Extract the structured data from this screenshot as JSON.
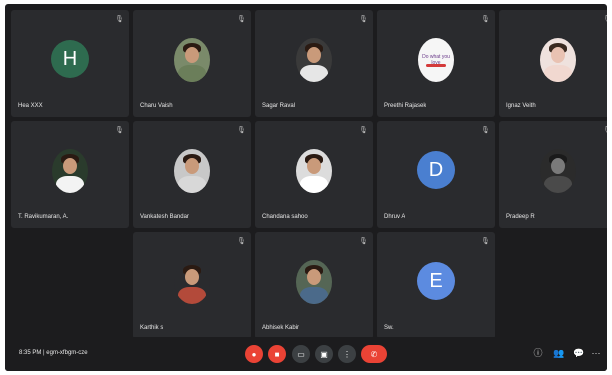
{
  "meeting": {
    "time": "8:35 PM",
    "separator": "|",
    "code": "egm-xfbgm-cze"
  },
  "participants": [
    {
      "name": "Hea XXX",
      "avatar": {
        "type": "letter",
        "letter": "H",
        "color": "#2e6b4f"
      }
    },
    {
      "name": "Charu Vaish",
      "avatar": {
        "type": "photo",
        "shirt": "#6b7e5a",
        "bg": "#7a8a6a"
      }
    },
    {
      "name": "Sagar Raval",
      "avatar": {
        "type": "photo",
        "shirt": "#e6e6e6",
        "bg": "#3a3a3a"
      }
    },
    {
      "name": "Preethi Rajasek",
      "avatar": {
        "type": "logo",
        "text": "Do what you love"
      }
    },
    {
      "name": "Ignaz Veith",
      "avatar": {
        "type": "photo",
        "shirt": "#f1d8d0",
        "bg": "#efe2de"
      }
    },
    {
      "name": "T. Ravikumaran, A.",
      "avatar": {
        "type": "photo",
        "shirt": "#f3f3f3",
        "bg": "#2a3b2c"
      }
    },
    {
      "name": "Vankatesh Bandar",
      "avatar": {
        "type": "photo",
        "shirt": "#d8d8d8",
        "bg": "#c8c8c8"
      }
    },
    {
      "name": "Chandana sahoo",
      "avatar": {
        "type": "photo",
        "shirt": "#ffffff",
        "bg": "#dcdcdc"
      }
    },
    {
      "name": "Dhruv A",
      "avatar": {
        "type": "letter",
        "letter": "D",
        "color": "#4a7fd0"
      }
    },
    {
      "name": "Pradeep R",
      "avatar": {
        "type": "photo",
        "shirt": "#4a4a4a",
        "bg": "#2b2b2b"
      }
    },
    {
      "name": "Karthik s",
      "avatar": {
        "type": "photo",
        "shirt": "#b34a3a",
        "bg": "#2a2b2e"
      }
    },
    {
      "name": "Abhisek Kabir",
      "avatar": {
        "type": "photo",
        "shirt": "#4b6a8a",
        "bg": "#556655"
      }
    },
    {
      "name": "Sw.",
      "avatar": {
        "type": "letter",
        "letter": "E",
        "color": "#5c8be0"
      }
    }
  ],
  "controls": {
    "mic_label": "mic-off",
    "cam_label": "camera-off",
    "captions_label": "captions",
    "present_label": "present",
    "more_label": "more",
    "end_label": "end-call"
  },
  "icons": {
    "mic_muted": "🎙",
    "more": "⋮",
    "end": "✆",
    "info": "ⓘ",
    "people": "👥",
    "chat": "💬",
    "activities": "⋯"
  },
  "colors": {
    "background": "#1c1c1e",
    "tile": "#2a2b2e",
    "danger": "#ea4335",
    "neutral": "#3c4043"
  }
}
